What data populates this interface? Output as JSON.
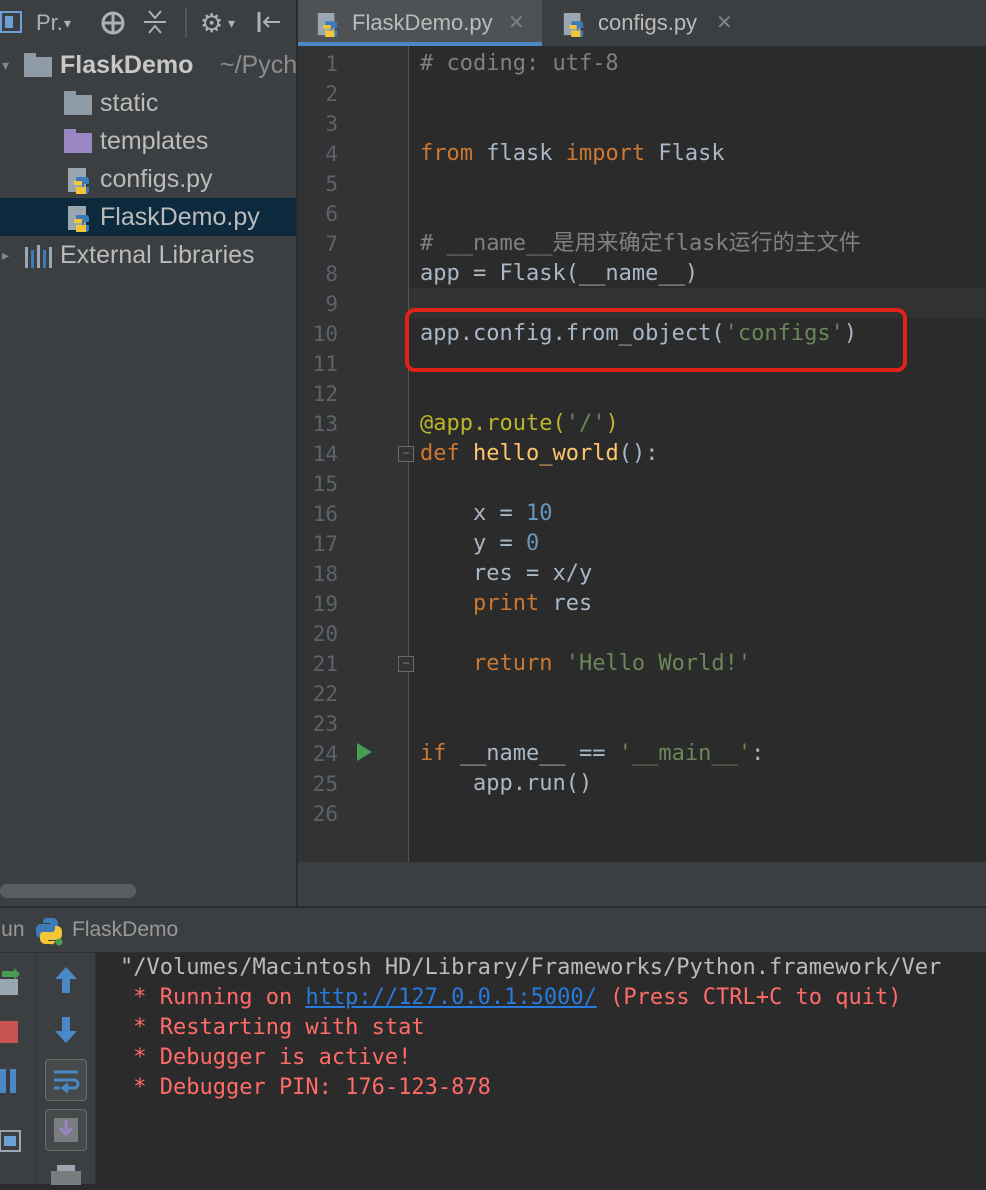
{
  "project_panel": {
    "toolbar": {
      "view_label": "Pr.",
      "icons": [
        "project-view-icon",
        "dropdown-icon",
        "target-icon",
        "collapse-icon",
        "gear-icon",
        "hide-icon"
      ]
    },
    "tree": [
      {
        "name": "FlaskDemo",
        "path_hint": "~/Pych",
        "type": "folder"
      },
      {
        "name": "static",
        "type": "folder"
      },
      {
        "name": "templates",
        "type": "folder"
      },
      {
        "name": "configs.py",
        "type": "python-file"
      },
      {
        "name": "FlaskDemo.py",
        "type": "python-file",
        "selected": true
      },
      {
        "name": "External Libraries",
        "type": "library"
      }
    ]
  },
  "tabs": [
    {
      "label": "FlaskDemo.py",
      "active": true
    },
    {
      "label": "configs.py",
      "active": false
    }
  ],
  "editor": {
    "line_numbers": [
      "1",
      "2",
      "3",
      "4",
      "5",
      "6",
      "7",
      "8",
      "9",
      "10",
      "11",
      "12",
      "13",
      "14",
      "15",
      "16",
      "17",
      "18",
      "19",
      "20",
      "21",
      "22",
      "23",
      "24",
      "25",
      "26"
    ],
    "code": {
      "l1": "# coding: utf-8",
      "l4_kw1": "from",
      "l4_mod": " flask ",
      "l4_kw2": "import",
      "l4_name": " Flask",
      "l7": "# __name__是用来确定flask运行的主文件",
      "l8": "app = Flask(__name__)",
      "l10_pre": "app.config.from_object(",
      "l10_str": "'configs'",
      "l10_post": ")",
      "l13_deco": "@app.route(",
      "l13_str": "'/'",
      "l13_post": ")",
      "l14_kw": "def",
      "l14_fn": " hello_world",
      "l14_post": "():",
      "l16_pre": "    x = ",
      "l16_num": "10",
      "l17_pre": "    y = ",
      "l17_num": "0",
      "l18": "    res = x/y",
      "l19_kw": "    print",
      "l19_post": " res",
      "l21_kw": "    return",
      "l21_str": " 'Hello World!'",
      "l24_kw": "if",
      "l24_mid": " __name__ == ",
      "l24_str": "'__main__'",
      "l24_post": ":",
      "l25": "    app.run()"
    },
    "highlighted_line": "10"
  },
  "run_panel": {
    "header_label": "Run",
    "config_name": "FlaskDemo",
    "console": {
      "line1": "\"/Volumes/Macintosh HD/Library/Frameworks/Python.framework/Ver",
      "line2_pre": " * Running on ",
      "line2_link": "http://127.0.0.1:5000/",
      "line2_post": " (Press CTRL+C to quit)",
      "line3": " * Restarting with stat",
      "line4": " * Debugger is active!",
      "line5": " * Debugger PIN: 176-123-878"
    }
  },
  "colors": {
    "keyword": "#cc7832",
    "string": "#6a8759",
    "number": "#6897bb",
    "comment": "#808080",
    "function": "#ffc66d",
    "error_text": "#ff6b68",
    "link": "#287bde",
    "highlight_box": "#e3211c"
  }
}
